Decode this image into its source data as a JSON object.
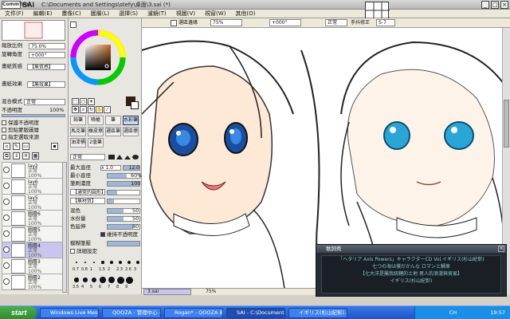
{
  "window": {
    "app_logo": "CommTool",
    "app_name": "SAI",
    "title": "C:\\Documents and Settings\\stefy\\桌面\\3.sai (*)",
    "minimize": "_",
    "maximize": "□",
    "close": "×"
  },
  "menu": [
    "文件(F)",
    "編輯(E)",
    "畫像(C)",
    "圖層(L)",
    "選擇(S)",
    "濾鏡(T)",
    "視圖(V)",
    "視窗(W)",
    "其他(O)"
  ],
  "navigator": {
    "zoom_label": "縮放比例",
    "zoom_value": "75.0%",
    "angle_label": "旋轉角度",
    "angle_value": "+000°"
  },
  "layer_props": {
    "tex_label": "畫紙質感",
    "tex_value": "【無質感】",
    "effect_label": "畫紙效果",
    "effect_value": "【無效果】",
    "blend_label": "混合模式",
    "blend_value": "正常",
    "opacity_label": "不透明度",
    "opacity_value": "100%",
    "options": [
      "保護不透明度",
      "剪貼蒙版圖層",
      "指定選取來源"
    ]
  },
  "layers": [
    {
      "name": "lay2",
      "mode": "正常",
      "opacity": "100%",
      "selected": false
    },
    {
      "name": "lay6",
      "mode": "正常",
      "opacity": "100%",
      "selected": false
    },
    {
      "name": "lay5",
      "mode": "正常",
      "opacity": "100%",
      "selected": false
    },
    {
      "name": "圖層6",
      "mode": "正常",
      "opacity": "100%",
      "selected": false
    },
    {
      "name": "圖層5",
      "mode": "正常",
      "opacity": "100%",
      "selected": false
    },
    {
      "name": "圖層4",
      "mode": "正常",
      "opacity": "100%",
      "selected": true
    },
    {
      "name": "圖層3",
      "mode": "正常",
      "opacity": "100%",
      "selected": false
    },
    {
      "name": "圖層2",
      "mode": "正常",
      "opacity": "100%",
      "selected": false
    }
  ],
  "tools": {
    "row1": [
      "鉛筆",
      "噴槍",
      "筆",
      "水彩筆"
    ],
    "row2": [
      "馬克筆",
      "橡皮擦",
      "選區筆",
      "選區擦"
    ],
    "row3": [
      "油漆桶",
      "2值筆"
    ],
    "blend_mode": "正常",
    "size_label": "最大直徑",
    "size_mult": "x 1.0",
    "size_value": "12.0",
    "min_label": "最小直徑",
    "min_value": "60%",
    "density_label": "筆刷濃度",
    "density_value": "100",
    "shape_value": "【通常的圓形】",
    "tex_value": "【無材質】",
    "blend_label": "混色",
    "blend_value": "50",
    "water_label": "水份量",
    "water_value": "50",
    "stretch_label": "色延伸",
    "stretch_value": "80",
    "keep_opacity": "維持不透明度",
    "blur_label": "模糊筆壓",
    "blur_value": "100%",
    "detail_label": "詳細設定",
    "brush_sizes": [
      "0.7",
      "0.8",
      "1",
      "1.5",
      "2",
      "2.3",
      "2.6",
      "3",
      "3.5",
      "4",
      "5",
      "6",
      "7",
      "8",
      "9"
    ],
    "accent": "#335"
  },
  "canvas_toolbar": {
    "selection": "選區邊緣",
    "zoom": "75%",
    "rotate": "+000°",
    "mode": "正常",
    "stab": "手抖修正",
    "stab_value": "S-7"
  },
  "statusbar": {
    "file": "3.sai",
    "zoom": "75%"
  },
  "popup": {
    "title": "歌詞秀",
    "line1": "「ヘタリア Axis Powers」キャラクターCD Vol.イギリス(杉山紀彰)",
    "line2": "七つの海は僕だかんな ロマンと鯛車",
    "line3": "【七大洋是屬我統轄的土地 男人的浪漫與貿易】",
    "line4": "イギリス(杉山紀彰)"
  },
  "taskbar": {
    "start": "start",
    "tasks": [
      {
        "label": "Windows Live Messen...",
        "active": false
      },
      {
        "label": "QOOZA - 管理中心 - ...",
        "active": false
      },
      {
        "label": "Rogan* - QOOZA B...",
        "active": false
      },
      {
        "label": "SAI - C:\\Documents a...",
        "active": true
      },
      {
        "label": "イギリス(杉山紀彰)...",
        "active": false
      }
    ],
    "lang": "CH",
    "clock": "19:57"
  },
  "colors": {
    "primary": "#3a1d0e",
    "secondary": "#ffffff"
  }
}
